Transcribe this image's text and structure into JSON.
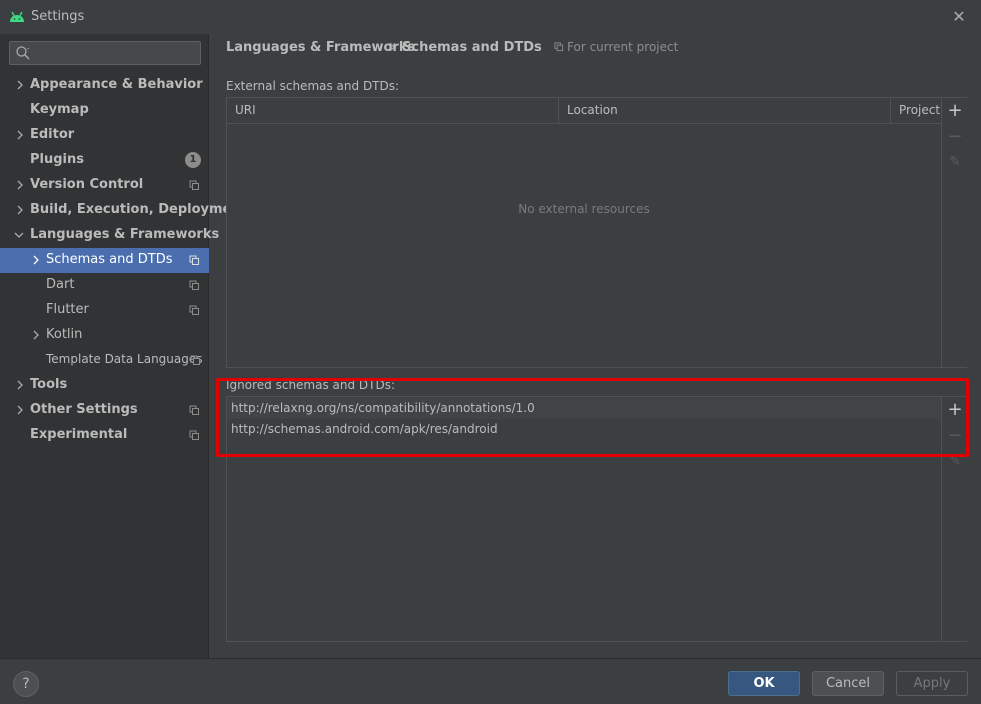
{
  "window": {
    "title": "Settings",
    "close_glyph": "✕",
    "app_icon": "android-icon"
  },
  "colors": {
    "accent": "#4b6eaf",
    "highlight": "#e20000",
    "ok_button": "#365880"
  },
  "search": {
    "placeholder": "",
    "value": ""
  },
  "sidebar": {
    "items": [
      {
        "label": "Appearance & Behavior",
        "bold": true,
        "expandable": true
      },
      {
        "label": "Keymap",
        "bold": true,
        "expandable": false
      },
      {
        "label": "Editor",
        "bold": true,
        "expandable": true
      },
      {
        "label": "Plugins",
        "bold": true,
        "expandable": false,
        "badge": "1"
      },
      {
        "label": "Version Control",
        "bold": true,
        "expandable": true
      },
      {
        "label": "Build, Execution, Deployment",
        "bold": true,
        "expandable": true
      },
      {
        "label": "Languages & Frameworks",
        "bold": true,
        "expanded": true
      },
      {
        "label": "Schemas and DTDs",
        "bold": false,
        "expandable": true,
        "selected": true
      },
      {
        "label": "Dart",
        "bold": false
      },
      {
        "label": "Flutter",
        "bold": false
      },
      {
        "label": "Kotlin",
        "bold": false,
        "expandable": true
      },
      {
        "label": "Template Data Languages",
        "bold": false
      },
      {
        "label": "Tools",
        "bold": true,
        "expandable": true
      },
      {
        "label": "Other Settings",
        "bold": true,
        "expandable": true
      },
      {
        "label": "Experimental",
        "bold": true
      }
    ]
  },
  "breadcrumb": {
    "parent": "Languages & Frameworks",
    "current": "Schemas and DTDs",
    "scope": "For current project"
  },
  "external": {
    "label": "External schemas and DTDs:",
    "columns": [
      "URI",
      "Location",
      "Project"
    ],
    "empty_text": "No external resources",
    "toolbar": {
      "add": "+",
      "remove": "−",
      "edit": "✎"
    }
  },
  "ignored": {
    "label": "Ignored schemas and DTDs:",
    "rows": [
      "http://relaxng.org/ns/compatibility/annotations/1.0",
      "http://schemas.android.com/apk/res/android"
    ],
    "toolbar": {
      "add": "+",
      "remove": "−",
      "edit": "✎"
    }
  },
  "footer": {
    "help": "?",
    "ok": "OK",
    "cancel": "Cancel",
    "apply": "Apply"
  }
}
